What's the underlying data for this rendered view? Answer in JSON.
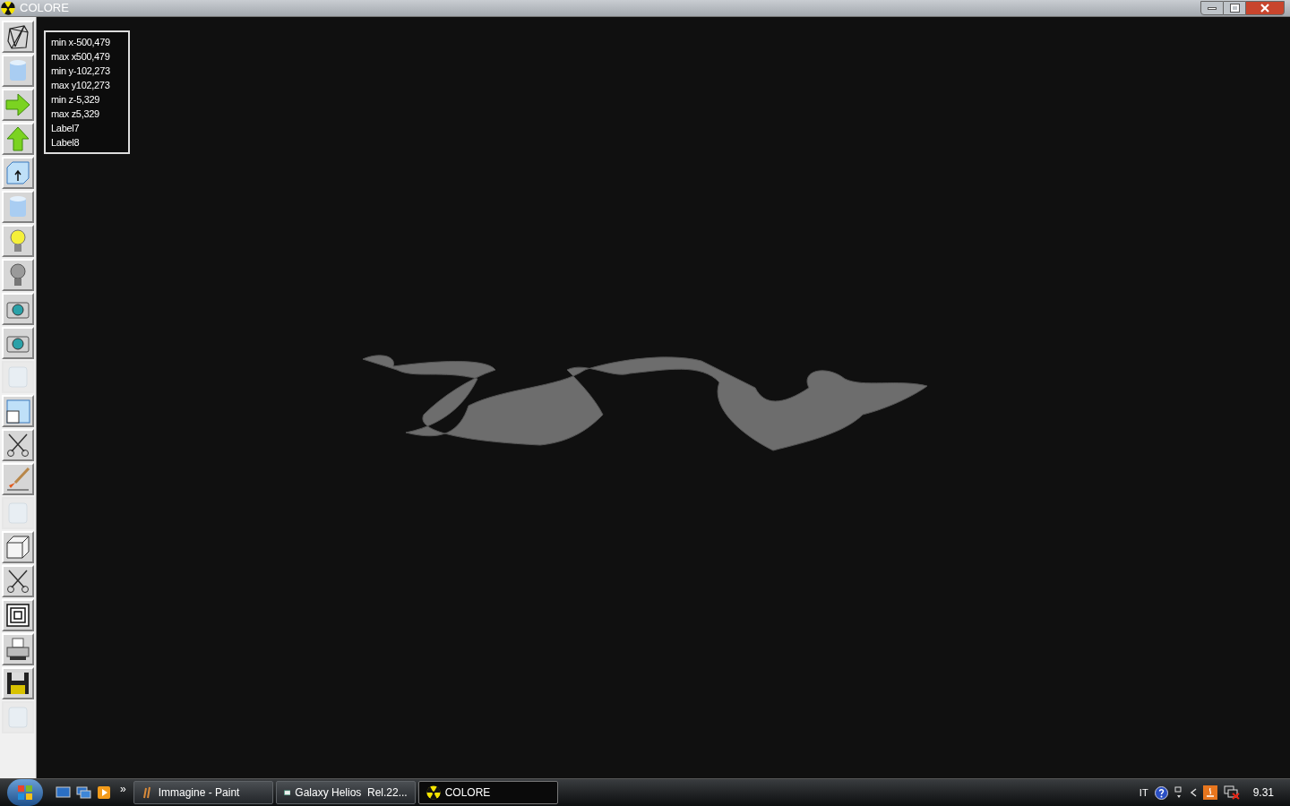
{
  "window": {
    "title": "COLORE"
  },
  "toolbar": [
    {
      "kind": "wireframe",
      "disabled": false
    },
    {
      "kind": "cylinder",
      "disabled": false
    },
    {
      "kind": "arrow-right",
      "disabled": false
    },
    {
      "kind": "arrow-up",
      "disabled": false
    },
    {
      "kind": "box-arrow",
      "disabled": false
    },
    {
      "kind": "cylinder",
      "disabled": false
    },
    {
      "kind": "bulb-on",
      "disabled": false
    },
    {
      "kind": "bulb-off",
      "disabled": false
    },
    {
      "kind": "camera",
      "disabled": false
    },
    {
      "kind": "camera",
      "disabled": false
    },
    {
      "kind": "blank",
      "disabled": true
    },
    {
      "kind": "window",
      "disabled": false
    },
    {
      "kind": "scissors",
      "disabled": false
    },
    {
      "kind": "brush",
      "disabled": false
    },
    {
      "kind": "blank",
      "disabled": true
    },
    {
      "kind": "cube",
      "disabled": false
    },
    {
      "kind": "scissors",
      "disabled": false
    },
    {
      "kind": "squares",
      "disabled": false
    },
    {
      "kind": "printer",
      "disabled": false
    },
    {
      "kind": "floppy",
      "disabled": false
    },
    {
      "kind": "blank",
      "disabled": true
    }
  ],
  "info_labels": [
    "min x-500,479",
    "max x500,479",
    "min y-102,273",
    "max y102,273",
    "min z-5,329",
    "max z5,329",
    "Label7",
    "Label8"
  ],
  "taskbar": {
    "overflow": "»",
    "tasks": [
      {
        "kind": "paint",
        "label": "Immagine - Paint",
        "selected": false
      },
      {
        "kind": "app",
        "label": "Galaxy Helios  Rel.22...",
        "selected": false
      },
      {
        "kind": "radiation",
        "label": "COLORE",
        "selected": true
      }
    ],
    "language": "IT",
    "clock": "9.31"
  }
}
